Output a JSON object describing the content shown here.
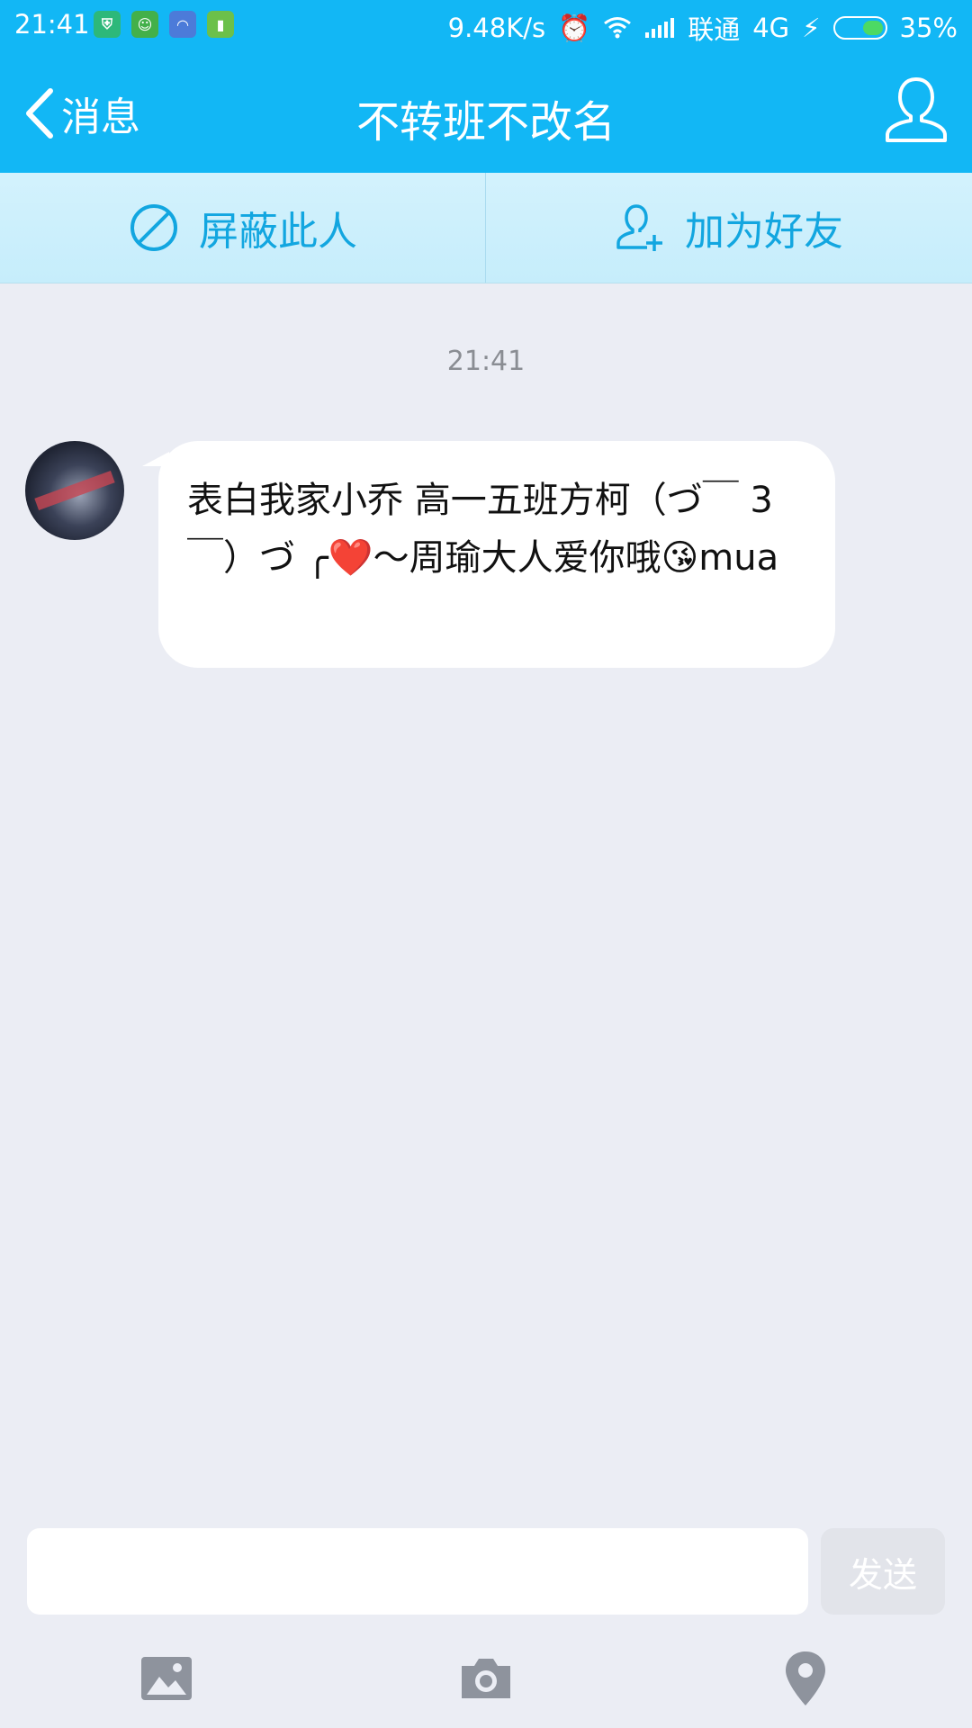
{
  "status_bar": {
    "time": "21:41",
    "net_speed": "9.48K/s",
    "carrier": "联通",
    "network": "4G",
    "battery": "35%",
    "notif_icons": [
      "shield-icon",
      "android-icon",
      "gauge-icon",
      "battery-app-icon"
    ],
    "colors": {
      "green1": "#2db87a",
      "green2": "#43b04a",
      "blue": "#4c7bd9",
      "green3": "#6cc04a"
    }
  },
  "header": {
    "back_label": "消息",
    "title": "不转班不改名",
    "profile_icon": "person-outline-icon"
  },
  "actions": {
    "block_label": "屏蔽此人",
    "add_friend_label": "加为好友"
  },
  "chat": {
    "timestamp": "21:41",
    "messages": [
      {
        "sender": "other",
        "text": "表白我家小乔 高一五班方柯（づ￣ 3￣）づ ╭❤️～周瑜大人爱你哦😘mua"
      }
    ]
  },
  "composer": {
    "input_value": "",
    "send_label": "发送"
  },
  "toolbar": {
    "icons": [
      "image-icon",
      "camera-icon",
      "location-pin-icon"
    ]
  },
  "colors": {
    "header_blue": "#12b7f5",
    "accent_text": "#12a6e0",
    "background": "#ebedf4"
  }
}
